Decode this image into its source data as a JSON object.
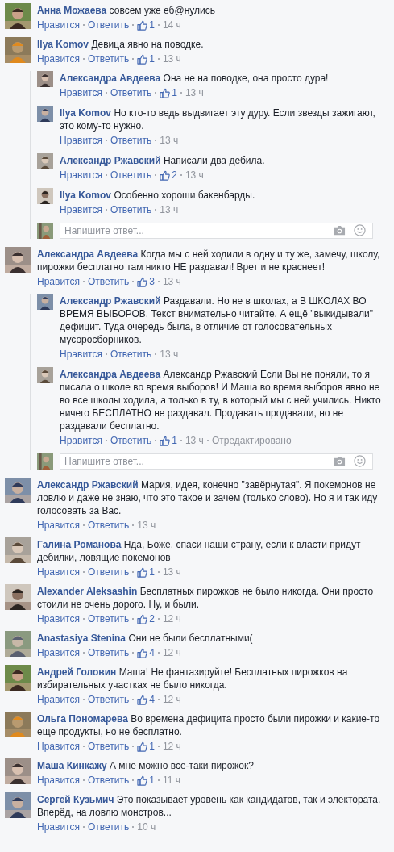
{
  "comments": [
    {
      "author": "Анна Можаева",
      "text": "совсем уже еб@нулись",
      "like": "Нравится",
      "reply": "Ответить",
      "likes": "1",
      "time": "14 ч"
    },
    {
      "author": "Ilya Komov",
      "text": "Девица явно на поводке.",
      "like": "Нравится",
      "reply": "Ответить",
      "likes": "1",
      "time": "13 ч",
      "replies": [
        {
          "author": "Александра Авдеева",
          "text": "Она не на поводке, она просто дура!",
          "like": "Нравится",
          "reply": "Ответить",
          "likes": "1",
          "time": "13 ч"
        },
        {
          "author": "Ilya Komov",
          "text": "Но кто-то ведь выдвигает эту дуру. Если звезды зажигают, это кому-то нужно.",
          "like": "Нравится",
          "reply": "Ответить",
          "time": "13 ч"
        },
        {
          "author": "Александр Ржавский",
          "text": "Написали два дебила.",
          "like": "Нравится",
          "reply": "Ответить",
          "likes": "2",
          "time": "13 ч"
        },
        {
          "author": "Ilya Komov",
          "text": "Особенно хороши бакенбарды.",
          "like": "Нравится",
          "reply": "Ответить",
          "time": "13 ч"
        }
      ],
      "reply_box": {
        "placeholder": "Напишите ответ..."
      }
    },
    {
      "author": "Александра Авдеева",
      "text": "Когда мы с ней ходили в одну и ту же, замечу, школу, пирожки бесплатно там никто НЕ раздавал! Врет и не краснеет!",
      "like": "Нравится",
      "reply": "Ответить",
      "likes": "3",
      "time": "13 ч",
      "replies": [
        {
          "author": "Александр Ржавский",
          "text": "Раздавали. Но не в школах, а В ШКОЛАХ ВО ВРЕМЯ ВЫБОРОВ. Текст внимательно читайте. А ещё \"выкидывали\" дефицит. Туда очередь была, в отличие от голосовательных мусоросборников.",
          "like": "Нравится",
          "reply": "Ответить",
          "time": "13 ч"
        },
        {
          "author": "Александра Авдеева",
          "text": "Александр Ржавский Если Вы не поняли, то я писала о школе во время выборов! И Маша во время выборов явно не во все школы ходила, а только в ту, в который мы с ней учились. Никто ничего БЕСПЛАТНО не раздавал. Продавать продавали, но не раздавали бесплатно.",
          "like": "Нравится",
          "reply": "Ответить",
          "likes": "1",
          "time": "13 ч",
          "edited": "Отредактировано"
        }
      ],
      "reply_box": {
        "placeholder": "Напишите ответ..."
      }
    },
    {
      "author": "Александр Ржавский",
      "text": "Мария, идея, конечно \"завёрнутая\". Я покемонов не ловлю и даже не знаю, что это такое и зачем (только слово). Но я и так иду голосовать за Вас.",
      "like": "Нравится",
      "reply": "Ответить",
      "time": "13 ч"
    },
    {
      "author": "Галина Романова",
      "text": "Нда, Боже, спаси наши страну, если к власти придут дебилки, ловящие покемонов",
      "like": "Нравится",
      "reply": "Ответить",
      "likes": "1",
      "time": "13 ч"
    },
    {
      "author": "Alexander Aleksashin",
      "text": "Бесплатных пирожков не было никогда. Они просто стоили не очень дорого. Ну, и были.",
      "like": "Нравится",
      "reply": "Ответить",
      "likes": "2",
      "time": "12 ч"
    },
    {
      "author": "Anastasiya Stenina",
      "text": "Они не были бесплатными(",
      "like": "Нравится",
      "reply": "Ответить",
      "likes": "4",
      "time": "12 ч"
    },
    {
      "author": "Андрей Головин",
      "text": "Маша! Не фантазируйте! Бесплатных пирожков на избирательных участках не было никогда.",
      "like": "Нравится",
      "reply": "Ответить",
      "likes": "4",
      "time": "12 ч"
    },
    {
      "author": "Ольга Пономарева",
      "text": "Во времена дефицита просто были пирожки и какие-то еще продукты, но не бесплатно.",
      "like": "Нравится",
      "reply": "Ответить",
      "likes": "1",
      "time": "12 ч"
    },
    {
      "author": "Маша Кинкажу",
      "text": "А мне можно все-таки пирожок?",
      "like": "Нравится",
      "reply": "Ответить",
      "likes": "1",
      "time": "11 ч"
    },
    {
      "author": "Сергей Кузьмич",
      "text": "Это показывает уровень как кандидатов, так и электората. Вперёд, на ловлю монстров...",
      "like": "Нравится",
      "reply": "Ответить",
      "time": "10 ч"
    }
  ]
}
